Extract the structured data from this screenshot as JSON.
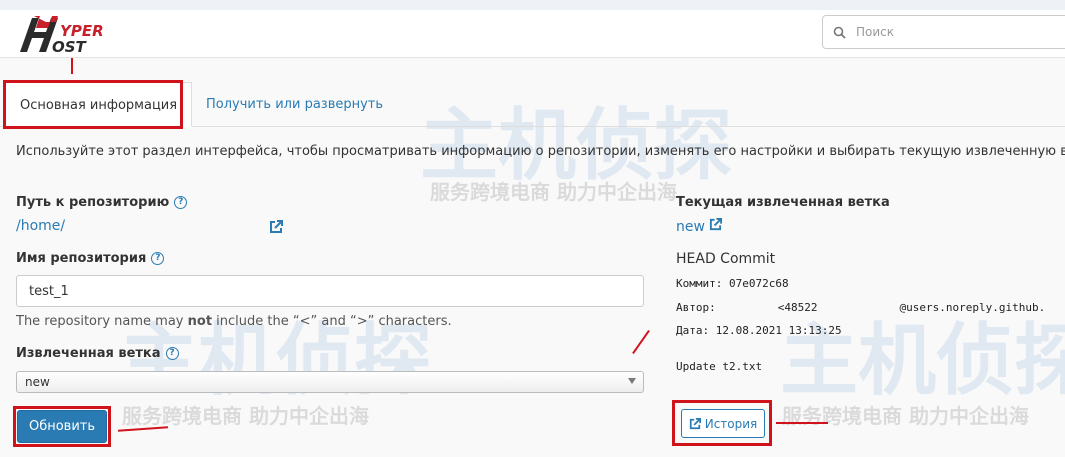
{
  "header": {
    "logo_text": "HYPER HOST",
    "search_placeholder": "Поиск"
  },
  "tabs": [
    {
      "label": "Основная информация"
    },
    {
      "label": "Получить или развернуть"
    }
  ],
  "description": "Используйте этот раздел интерфейса, чтобы просматривать информацию о репозитории, изменять его настройки и выбирать текущую извлеченную ветку.",
  "left": {
    "repo_path_label": "Путь к репозиторию",
    "repo_path_value": "/home/",
    "repo_name_label": "Имя репозитория",
    "repo_name_value": "test_1",
    "hint_pre": "The repository name may ",
    "hint_bold": "not",
    "hint_post": " include the “<” and “>” characters.",
    "branch_label": "Извлеченная ветка",
    "branch_value": "new",
    "update_button": "Обновить"
  },
  "right": {
    "current_branch_label": "Текущая извлеченная ветка",
    "current_branch_value": "new",
    "head_commit_label": "HEAD Commit",
    "commit_line": "Коммит: 07e072c68",
    "author_label": "Автор:",
    "author_email_start": "<48522",
    "author_email_end": "@users.noreply.github.",
    "date_line": "Дата: 12.08.2021 13:13:25",
    "message": "Update t2.txt",
    "history_button": "История"
  },
  "watermark": {
    "title": "主机侦探",
    "subtitle": "服务跨境电商 助力中企出海"
  },
  "colors": {
    "accent": "#2a7bb3",
    "highlight": "#d0121b"
  }
}
